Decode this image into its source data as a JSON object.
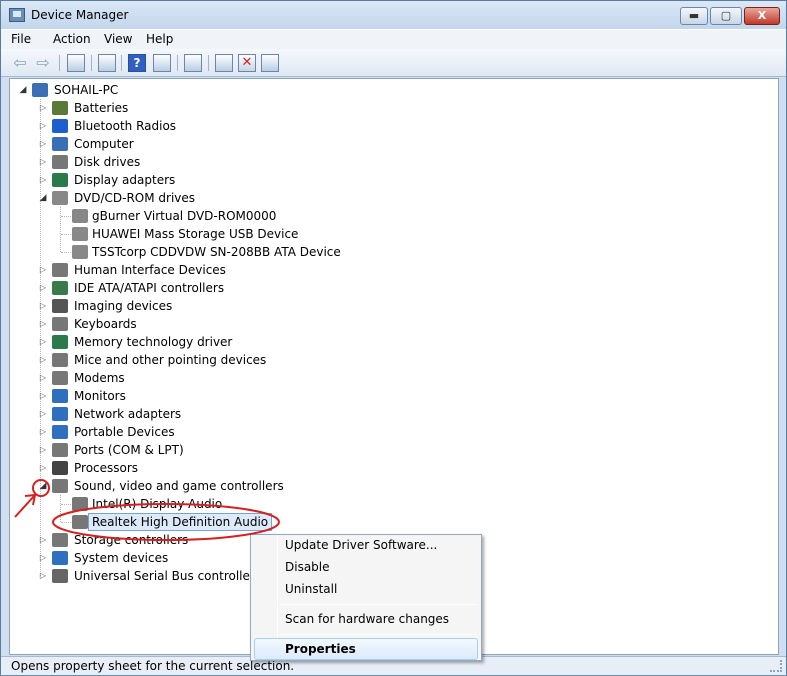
{
  "window": {
    "title": "Device Manager"
  },
  "titlebar_buttons": {
    "minimize": "▬",
    "maximize": "▢",
    "close": "X"
  },
  "menu": [
    "File",
    "Action",
    "View",
    "Help"
  ],
  "toolbar_icons": [
    "back-arrow-icon",
    "forward-arrow-icon",
    "show-hide-console-tree-icon",
    "properties-icon",
    "help-icon",
    "show-hidden-icon",
    "update-driver-icon",
    "uninstall-icon",
    "scan-hardware-changes-icon"
  ],
  "tree": {
    "root": "SOHAIL-PC",
    "categories": [
      {
        "label": "Batteries",
        "icon": "battery-icon",
        "color": "#5a7a3a"
      },
      {
        "label": "Bluetooth Radios",
        "icon": "bluetooth-icon",
        "color": "#1e5fd0"
      },
      {
        "label": "Computer",
        "icon": "computer-icon",
        "color": "#3a6fb5"
      },
      {
        "label": "Disk drives",
        "icon": "disk-drive-icon",
        "color": "#777777"
      },
      {
        "label": "Display adapters",
        "icon": "display-adapter-icon",
        "color": "#2a7a4a"
      },
      {
        "label": "DVD/CD-ROM drives",
        "icon": "dvd-drive-icon",
        "color": "#888888",
        "children": [
          "gBurner Virtual DVD-ROM0000",
          "HUAWEI Mass Storage USB Device",
          "TSSTcorp CDDVDW SN-208BB ATA Device"
        ]
      },
      {
        "label": "Human Interface Devices",
        "icon": "hid-icon",
        "color": "#777777"
      },
      {
        "label": "IDE ATA/ATAPI controllers",
        "icon": "ide-controller-icon",
        "color": "#3a7a4a"
      },
      {
        "label": "Imaging devices",
        "icon": "camera-icon",
        "color": "#555555"
      },
      {
        "label": "Keyboards",
        "icon": "keyboard-icon",
        "color": "#777777"
      },
      {
        "label": "Memory technology driver",
        "icon": "memory-icon",
        "color": "#2a7a4a"
      },
      {
        "label": "Mice and other pointing devices",
        "icon": "mouse-icon",
        "color": "#777777"
      },
      {
        "label": "Modems",
        "icon": "modem-icon",
        "color": "#777777"
      },
      {
        "label": "Monitors",
        "icon": "monitor-icon",
        "color": "#2f6fc0"
      },
      {
        "label": "Network adapters",
        "icon": "network-adapter-icon",
        "color": "#2f6fc0"
      },
      {
        "label": "Portable Devices",
        "icon": "portable-device-icon",
        "color": "#2f6fc0"
      },
      {
        "label": "Ports (COM & LPT)",
        "icon": "port-icon",
        "color": "#777777"
      },
      {
        "label": "Processors",
        "icon": "processor-icon",
        "color": "#444444"
      },
      {
        "label": "Sound, video and game controllers",
        "icon": "speaker-icon",
        "color": "#777777",
        "children": [
          "Intel(R) Display Audio",
          "Realtek High Definition Audio"
        ]
      },
      {
        "label": "Storage controllers",
        "icon": "storage-controller-icon",
        "color": "#777777"
      },
      {
        "label": "System devices",
        "icon": "system-device-icon",
        "color": "#2f6fc0"
      },
      {
        "label": "Universal Serial Bus controllers",
        "icon": "usb-icon",
        "color": "#666666"
      }
    ]
  },
  "context_menu": {
    "items": [
      "Update Driver Software...",
      "Disable",
      "Uninstall",
      "Scan for hardware changes",
      "Properties"
    ],
    "highlighted": "Properties"
  },
  "statusbar": {
    "text": "Opens property sheet for the current selection."
  },
  "annotation_color": "#d42020"
}
